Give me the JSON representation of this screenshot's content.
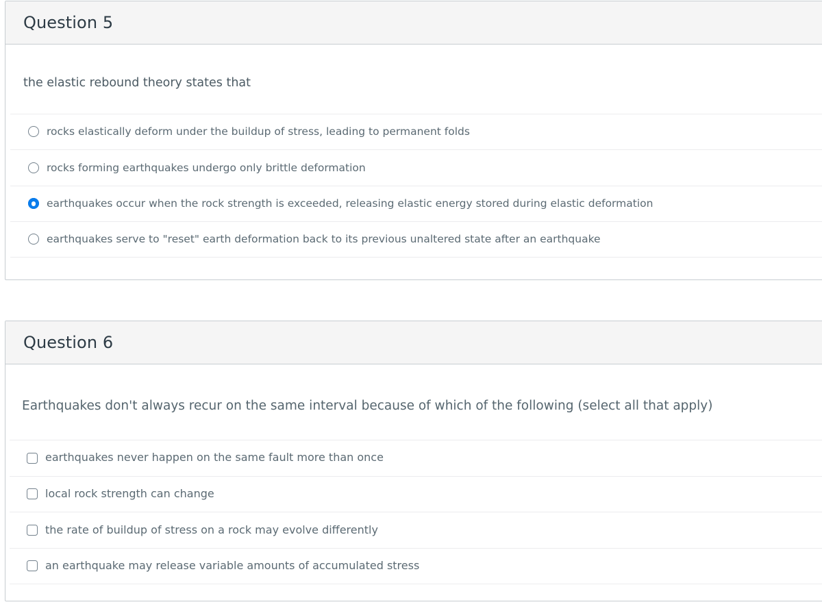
{
  "theme": {
    "accent": "#0a7ceb",
    "header_bg": "#f5f5f5",
    "card_border": "#c7cdd1",
    "divider": "#ececee",
    "title_color": "#2d3b45",
    "body_text_color": "#5b6a73"
  },
  "questions": [
    {
      "header": "Question 5",
      "prompt": "the elastic rebound theory states that",
      "input_type": "radio",
      "options": [
        {
          "label": "rocks elastically deform under the buildup of stress, leading to permanent folds",
          "selected": false
        },
        {
          "label": "rocks forming earthquakes undergo only brittle deformation",
          "selected": false
        },
        {
          "label": "earthquakes occur when the rock strength is exceeded, releasing elastic energy stored during elastic deformation",
          "selected": true
        },
        {
          "label": "earthquakes serve to \"reset\" earth deformation back to its previous unaltered state after an earthquake",
          "selected": false
        }
      ]
    },
    {
      "header": "Question 6",
      "prompt": "Earthquakes don't always recur on the same interval because of which of the following (select all that apply)",
      "input_type": "checkbox",
      "options": [
        {
          "label": "earthquakes never happen on the same fault more than once",
          "selected": false
        },
        {
          "label": "local rock strength can change",
          "selected": false
        },
        {
          "label": "the rate of buildup of stress on a rock may evolve differently",
          "selected": false
        },
        {
          "label": "an earthquake may release variable amounts of accumulated stress",
          "selected": false
        }
      ]
    }
  ]
}
